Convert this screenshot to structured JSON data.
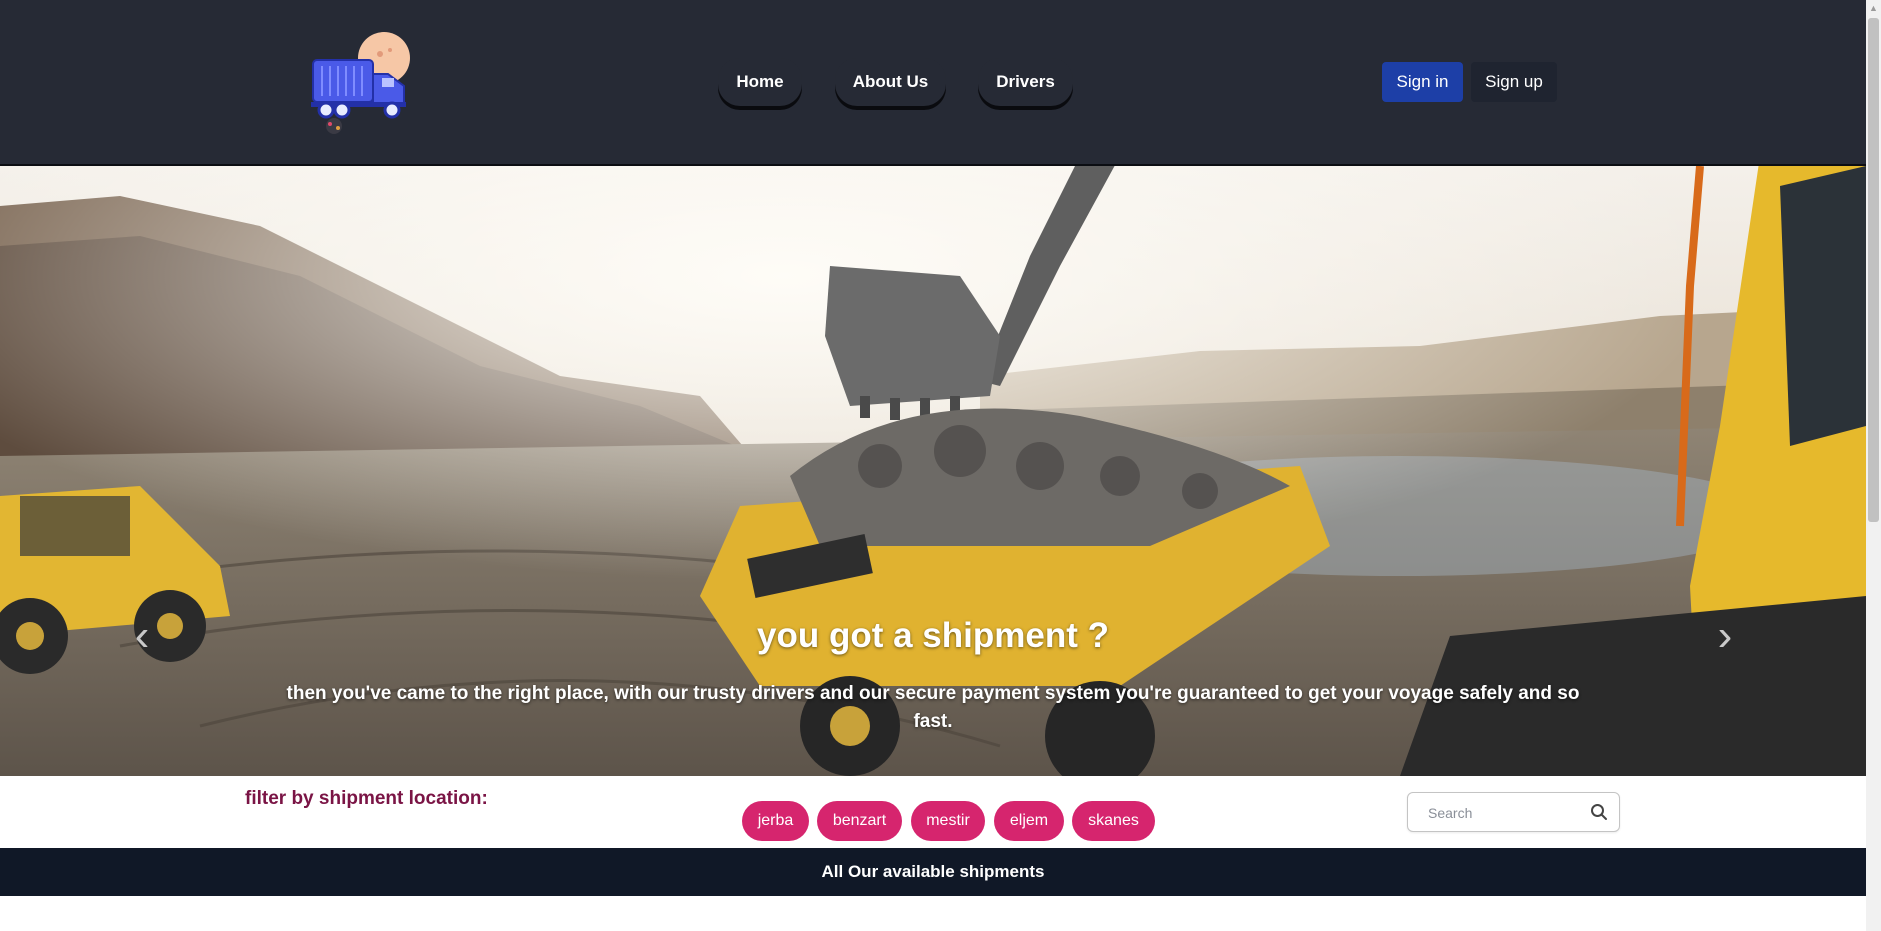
{
  "header": {
    "logo_name": "truck-logo",
    "nav": [
      {
        "label": "Home"
      },
      {
        "label": "About Us"
      },
      {
        "label": "Drivers"
      }
    ],
    "sign_in": "Sign in",
    "sign_up": "Sign up"
  },
  "hero": {
    "title": "you got a shipment ?",
    "text": "then you've came to the right place, with our trusty drivers and our secure payment system you're guaranteed to get your voyage safely and so fast.",
    "prev_icon": "chevron-left-icon",
    "next_icon": "chevron-right-icon",
    "slides": 3,
    "active_slide": 1
  },
  "filter": {
    "label": "filter by shipment location:",
    "locations": [
      "jerba",
      "benzart",
      "mestir",
      "eljem",
      "skanes"
    ],
    "search_placeholder": "Search"
  },
  "band": {
    "text": "All Our available shipments"
  },
  "colors": {
    "header_bg": "#262a35",
    "sign_in_bg": "#1d3fa7",
    "chip_bg": "#d6256e",
    "filter_label": "#7a1445",
    "band_bg": "#101827"
  }
}
